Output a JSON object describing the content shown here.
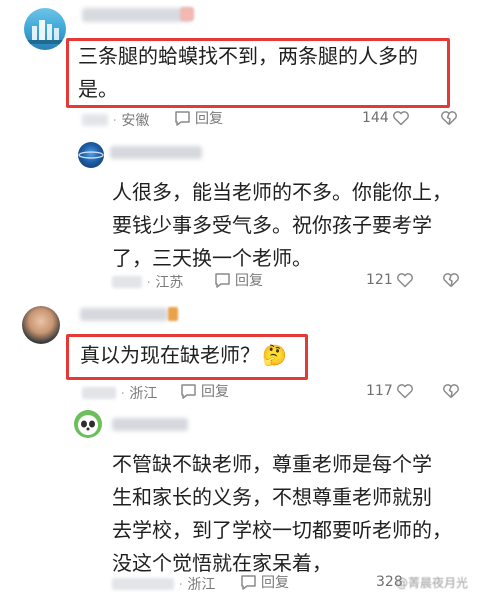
{
  "comments": [
    {
      "text": "三条腿的蛤蟆找不到，两条腿的人多的是。",
      "line1": "三条腿的蛤蟆找不到，两条腿的人多的",
      "line2": "是。",
      "location": "安徽",
      "reply_label": "回复",
      "likes": "144"
    },
    {
      "line1": "人很多，能当老师的不多。你能你上，",
      "line2": "要钱少事多受气多。祝你孩子要考学",
      "line3": "了，三天换一个老师。",
      "location": "江苏",
      "reply_label": "回复",
      "likes": "121"
    },
    {
      "text": "真以为现在缺老师？",
      "emoji": "🤔",
      "location": "浙江",
      "reply_label": "回复",
      "likes": "117"
    },
    {
      "line1": "不管缺不缺老师，尊重老师是每个学",
      "line2": "生和家长的义务，不想尊重老师就别",
      "line3": "去学校，到了学校一切都要听老师的，",
      "line4": "没这个觉悟就在家呆着，",
      "location": "浙江",
      "reply_label": "回复",
      "likes": "328"
    }
  ],
  "watermark": "@菁晨夜月光",
  "colors": {
    "highlight": "#e53935",
    "meta": "#7a7a7a"
  }
}
